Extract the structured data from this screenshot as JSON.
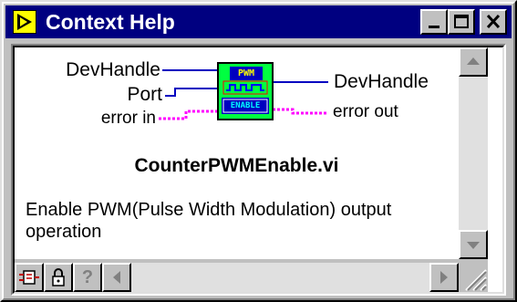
{
  "window": {
    "title": "Context Help",
    "colors": {
      "titlebar": "#000080",
      "face": "#c0c0c0",
      "wire_pink": "#ff00ff",
      "wire_blue": "#0000c0",
      "icon_green": "#00ff40"
    }
  },
  "connector_pane": {
    "inputs": [
      "DevHandle",
      "Port",
      "error in"
    ],
    "outputs": [
      "DevHandle",
      "error out"
    ],
    "icon_top_text": "PWM",
    "icon_bottom_text": "ENABLE"
  },
  "vi_name": "CounterPWMEnable.vi",
  "description": "Enable PWM(Pulse Width Modulation) output operation",
  "toolbar": {
    "buttons": [
      {
        "icon": "simple-diagram-icon"
      },
      {
        "icon": "lock-icon"
      },
      {
        "icon": "question-mark-icon",
        "label": "?"
      }
    ]
  }
}
